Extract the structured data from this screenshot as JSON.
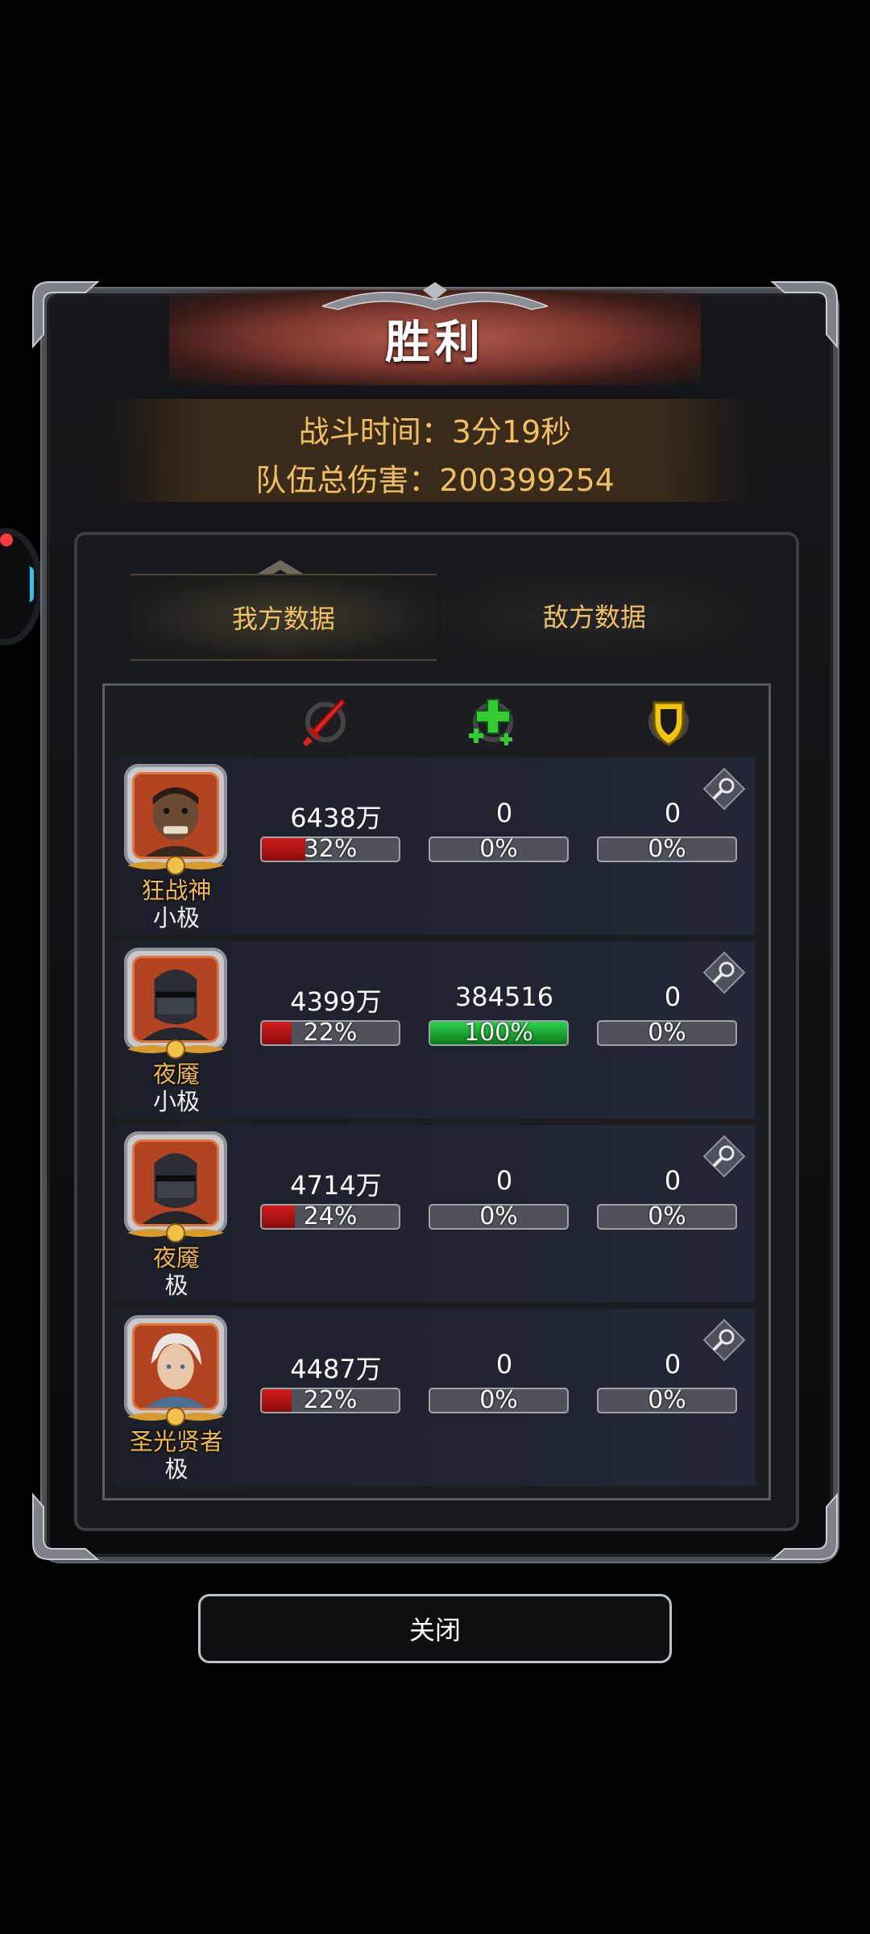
{
  "title": "胜利",
  "battle_time": "战斗时间：3分19秒",
  "team_damage": "队伍总伤害：200399254",
  "tabs": [
    "我方数据",
    "敌方数据"
  ],
  "columns": [
    {
      "icon": "sword-icon",
      "color": "#e0231e"
    },
    {
      "icon": "heal-cross-icon",
      "color": "#33cc33"
    },
    {
      "icon": "shield-icon",
      "color": "#f2c40c"
    }
  ],
  "heroes": [
    {
      "name": "狂战神",
      "tier": "小极",
      "portrait": "brute-portrait",
      "damage": "6438万",
      "damage_pct": "32%",
      "damage_frac": 0.32,
      "heal": "0",
      "heal_pct": "0%",
      "heal_frac": 0,
      "tank": "0",
      "tank_pct": "0%",
      "tank_frac": 0
    },
    {
      "name": "夜魇",
      "tier": "小极",
      "portrait": "masked-knight-portrait",
      "damage": "4399万",
      "damage_pct": "22%",
      "damage_frac": 0.22,
      "heal": "384516",
      "heal_pct": "100%",
      "heal_frac": 1.0,
      "tank": "0",
      "tank_pct": "0%",
      "tank_frac": 0
    },
    {
      "name": "夜魇",
      "tier": "极",
      "portrait": "masked-knight-portrait",
      "damage": "4714万",
      "damage_pct": "24%",
      "damage_frac": 0.24,
      "heal": "0",
      "heal_pct": "0%",
      "heal_frac": 0,
      "tank": "0",
      "tank_pct": "0%",
      "tank_frac": 0
    },
    {
      "name": "圣光贤者",
      "tier": "极",
      "portrait": "white-haired-sage-portrait",
      "damage": "4487万",
      "damage_pct": "22%",
      "damage_frac": 0.22,
      "heal": "0",
      "heal_pct": "0%",
      "heal_frac": 0,
      "tank": "0",
      "tank_pct": "0%",
      "tank_frac": 0
    }
  ],
  "close_label": "关闭"
}
